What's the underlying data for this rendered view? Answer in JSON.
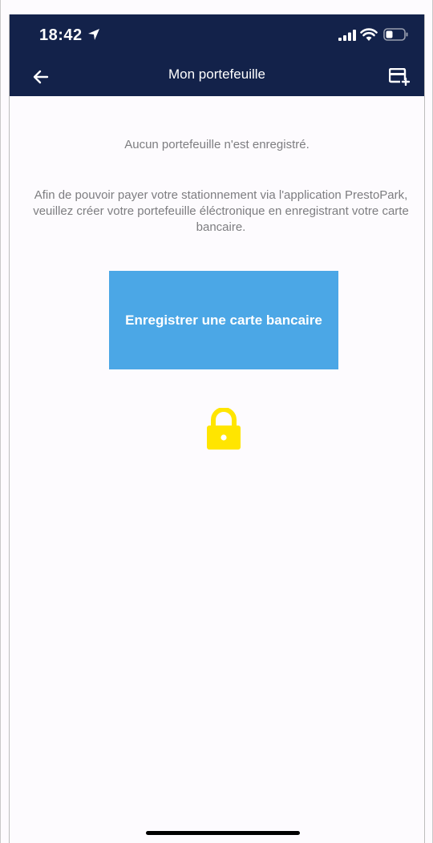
{
  "status_bar": {
    "time": "18:42"
  },
  "nav": {
    "title": "Mon portefeuille"
  },
  "content": {
    "empty_message": "Aucun portefeuille n'est enregistré.",
    "info_text": "Afin de pouvoir payer votre stationnement via l'application PrestoPark, veuillez créer votre portefeuille éléctronique en enregistrant votre carte bancaire.",
    "register_button_label": "Enregistrer une carte bancaire"
  },
  "icons": {
    "back": "arrow-left-icon",
    "add_card": "add-card-icon",
    "lock": "lock-icon",
    "location": "location-arrow-icon",
    "signal": "signal-icon",
    "wifi": "wifi-icon",
    "battery": "battery-icon"
  },
  "colors": {
    "header_bg": "#13224a",
    "button_bg": "#4ba7e6",
    "lock": "#ffe500",
    "text_muted": "#7d7d80",
    "background": "#fdfbfe"
  }
}
